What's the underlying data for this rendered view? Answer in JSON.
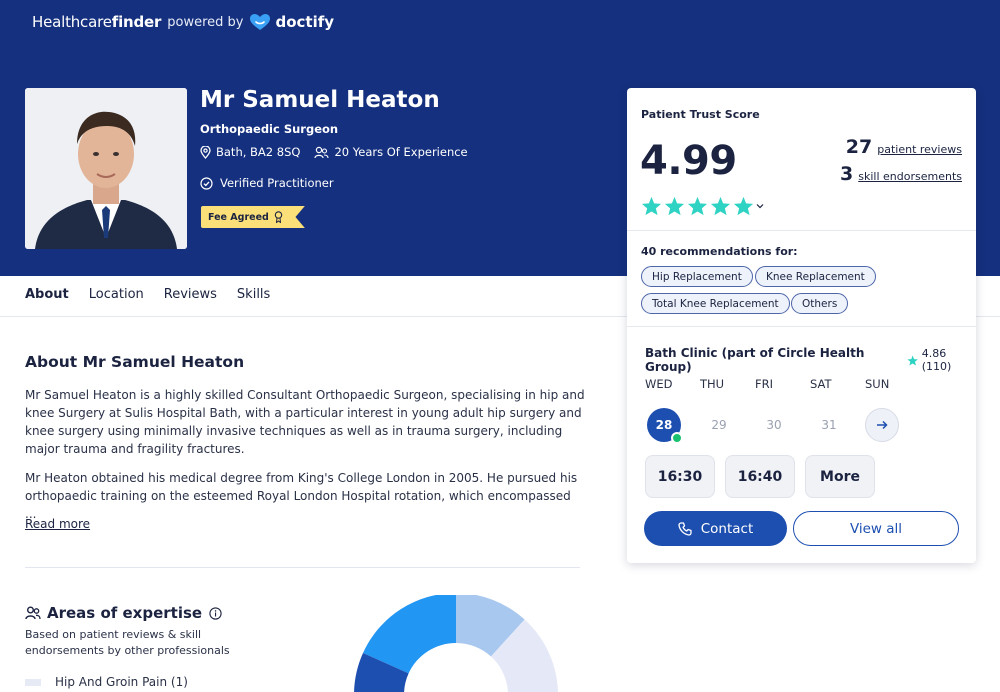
{
  "header": {
    "brand_light": "Healthcare",
    "brand_bold": "finder",
    "powered_by": "powered by",
    "partner": "doctify"
  },
  "doctor": {
    "name": "Mr Samuel Heaton",
    "specialty": "Orthopaedic Surgeon",
    "location": "Bath, BA2 8SQ",
    "experience": "20 Years Of Experience",
    "verified": "Verified Practitioner",
    "fee_badge": "Fee Agreed"
  },
  "tabs": [
    "About",
    "Location",
    "Reviews",
    "Skills"
  ],
  "about": {
    "title": "About Mr Samuel Heaton",
    "paragraph1": "Mr Samuel Heaton is a highly skilled Consultant Orthopaedic Surgeon, specialising in hip and knee Surgery at Sulis Hospital Bath, with a particular interest in young adult hip surgery and knee surgery using minimally invasive techniques as well as in trauma surgery, including major trauma and fragility fractures.",
    "paragraph2": "Mr Heaton obtained his medical degree from King's College London in 2005. He pursued his orthopaedic training on the esteemed Royal London Hospital rotation, which encompassed ...",
    "read_more": "Read more"
  },
  "expertise": {
    "title": "Areas of expertise",
    "subtitle": "Based on patient reviews & skill endorsements by other professionals",
    "legend_first": "Hip And Groin Pain (1)"
  },
  "trust": {
    "label": "Patient Trust Score",
    "score": "4.99",
    "stars": 5,
    "reviews_count": "27",
    "reviews_label": "patient reviews",
    "endorsements_count": "3",
    "endorsements_label": "skill endorsements",
    "recommendations_label": "40 recommendations for:",
    "chips": [
      "Hip Replacement",
      "Knee Replacement",
      "Total Knee Replacement",
      "Others"
    ]
  },
  "booking": {
    "clinic": "Bath Clinic (part of Circle Health Group)",
    "clinic_rating": "4.86 (110)",
    "days": [
      "WED",
      "THU",
      "FRI",
      "SAT",
      "SUN"
    ],
    "dates": [
      "28",
      "29",
      "30",
      "31"
    ],
    "slots": [
      "16:30",
      "16:40",
      "More"
    ],
    "contact_label": "Contact",
    "view_all_label": "View all"
  },
  "colors": {
    "header_bg": "#15307e",
    "primary": "#1d4fb0",
    "star": "#2fd3c4",
    "fee_badge": "#fbe07a",
    "available_dot": "#19c070"
  }
}
